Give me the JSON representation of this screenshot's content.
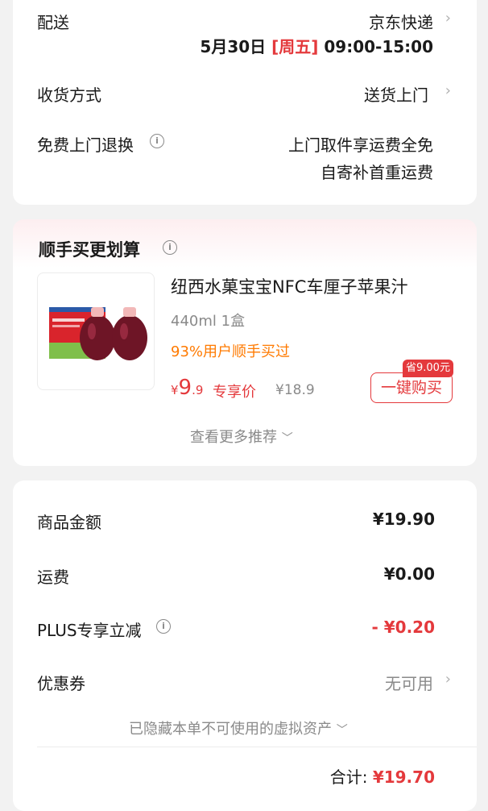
{
  "delivery": {
    "label": "配送",
    "carrier": "京东快递",
    "date": "5月30日",
    "weekday": "[周五]",
    "time": "09:00-15:00"
  },
  "receive": {
    "label": "收货方式",
    "value": "送货上门"
  },
  "free_return": {
    "label": "免费上门退换",
    "line1": "上门取件享运费全免",
    "line2": "自寄补首重运费"
  },
  "upsell": {
    "title": "顺手买更划算",
    "product_name": "纽西水菓宝宝NFC车厘子苹果汁",
    "spec": "440ml 1盒",
    "social_proof": "93%用户顺手买过",
    "currency": "¥",
    "price_int": "9",
    "price_dec": ".9",
    "price_tag": "专享价",
    "original_price": "¥18.9",
    "save_tag": "省9.00元",
    "buy_button": "一键购买",
    "more_link": "查看更多推荐"
  },
  "summary": {
    "rows": [
      {
        "label": "商品金额",
        "value": "¥19.90"
      },
      {
        "label": "运费",
        "value": "¥0.00"
      },
      {
        "label": "PLUS专享立减",
        "value": "- ¥0.20"
      },
      {
        "label": "优惠券",
        "value": "无可用"
      }
    ],
    "hidden_assets": "已隐藏本单不可使用的虚拟资产",
    "total_label": "合计:",
    "total_value": "¥19.70"
  },
  "colors": {
    "accent_red": "#e4393c",
    "accent_orange": "#ff7a00",
    "background": "#f2f2f2"
  }
}
